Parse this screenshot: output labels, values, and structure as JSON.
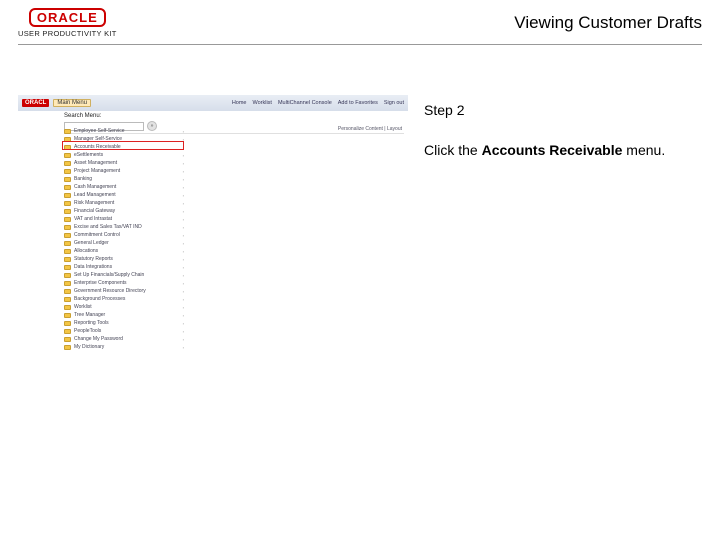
{
  "header": {
    "brand": "ORACLE",
    "subtitle": "USER PRODUCTIVITY KIT",
    "doc_title": "Viewing Customer Drafts"
  },
  "instructions": {
    "step_label": "Step 2",
    "line_prefix": "Click the ",
    "line_bold": "Accounts Receivable",
    "line_suffix": " menu."
  },
  "screenshot": {
    "logo_small": "ORACL",
    "main_menu_label": "Main Menu",
    "search_label": "Search Menu:",
    "search_go": "»",
    "personalize": "Personalize Content | Layout",
    "nav": {
      "home": "Home",
      "worklist": "Worklist",
      "mcc": "MultiChannel Console",
      "atf": "Add to Favorites",
      "signout": "Sign out"
    },
    "menu": [
      "Employee Self-Service",
      "Manager Self-Service",
      "Accounts Receivable",
      "eSettlements",
      "Asset Management",
      "Project Management",
      "Banking",
      "Cash Management",
      "Lead Management",
      "Risk Management",
      "Financial Gateway",
      "VAT and Intrastat",
      "Excise and Sales Tax/VAT IND",
      "Commitment Control",
      "General Ledger",
      "Allocations",
      "Statutory Reports",
      "Data Integrations",
      "Set Up Financials/Supply Chain",
      "Enterprise Components",
      "Government Resource Directory",
      "Background Processes",
      "Worklist",
      "Tree Manager",
      "Reporting Tools",
      "PeopleTools",
      "Change My Password",
      "My Dictionary"
    ]
  }
}
